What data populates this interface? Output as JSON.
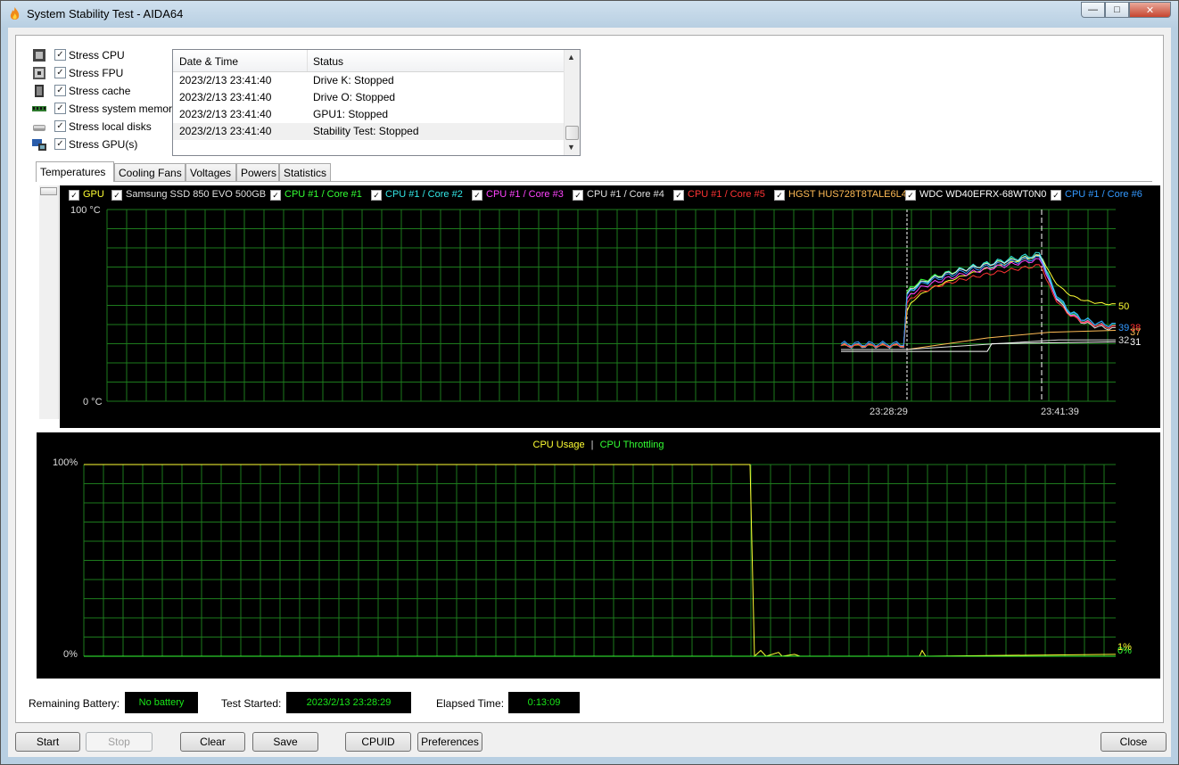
{
  "window": {
    "title": "System Stability Test - AIDA64",
    "min_glyph": "—",
    "max_glyph": "□",
    "close_glyph": "✕"
  },
  "stress_options": [
    {
      "label": "Stress CPU",
      "checked": true,
      "icon": "cpu-icon"
    },
    {
      "label": "Stress FPU",
      "checked": true,
      "icon": "fpu-icon"
    },
    {
      "label": "Stress cache",
      "checked": true,
      "icon": "cache-icon"
    },
    {
      "label": "Stress system memory",
      "checked": true,
      "icon": "memory-icon"
    },
    {
      "label": "Stress local disks",
      "checked": true,
      "icon": "disk-icon"
    },
    {
      "label": "Stress GPU(s)",
      "checked": true,
      "icon": "gpu-icon"
    }
  ],
  "log": {
    "headers": {
      "datetime": "Date & Time",
      "status": "Status"
    },
    "rows": [
      {
        "datetime": "2023/2/13 23:41:40",
        "status": "Drive K: Stopped"
      },
      {
        "datetime": "2023/2/13 23:41:40",
        "status": "Drive O: Stopped"
      },
      {
        "datetime": "2023/2/13 23:41:40",
        "status": "GPU1: Stopped"
      },
      {
        "datetime": "2023/2/13 23:41:40",
        "status": "Stability Test: Stopped"
      }
    ]
  },
  "tabs": [
    "Temperatures",
    "Cooling Fans",
    "Voltages",
    "Powers",
    "Statistics"
  ],
  "temperature_graph": {
    "legend": [
      {
        "label": "GPU",
        "color": "#ffff33"
      },
      {
        "label": "Samsung SSD 850 EVO 500GB",
        "color": "#e0e0e0"
      },
      {
        "label": "CPU #1 / Core #1",
        "color": "#33ff33"
      },
      {
        "label": "CPU #1 / Core #2",
        "color": "#33e6e6"
      },
      {
        "label": "CPU #1 / Core #3",
        "color": "#ff44ff"
      },
      {
        "label": "CPU #1 / Core #4",
        "color": "#e0e0e0"
      },
      {
        "label": "CPU #1 / Core #5",
        "color": "#ff3333"
      },
      {
        "label": "HGST HUS728T8TALE6L4",
        "color": "#ffbb55"
      },
      {
        "label": "WDC WD40EFRX-68WT0N0",
        "color": "#ffffff"
      },
      {
        "label": "CPU #1 / Core #6",
        "color": "#3399ff"
      }
    ],
    "y_max_label": "100 °C",
    "y_min_label": "0 °C",
    "time_start": "23:28:29",
    "time_end": "23:41:39",
    "end_values": [
      {
        "text": "50",
        "color": "#ffff33"
      },
      {
        "text": "39",
        "color": "#3399ff"
      },
      {
        "text": "38",
        "color": "#ff3333"
      },
      {
        "text": "37",
        "color": "#ffbb55"
      },
      {
        "text": "32",
        "color": "#e0e0e0"
      },
      {
        "text": "31",
        "color": "#ffffff"
      }
    ]
  },
  "cpu_graph": {
    "title_usage": "CPU Usage",
    "separator": "|",
    "title_throttling": "CPU Throttling",
    "usage_color": "#ffff33",
    "throttle_color": "#33ff33",
    "y_max_label": "100%",
    "y_min_label": "0%",
    "end_value_throttle": "0%",
    "end_value_usage": "1%"
  },
  "status_bar": {
    "battery_label": "Remaining Battery:",
    "battery_value": "No battery",
    "started_label": "Test Started:",
    "started_value": "2023/2/13 23:28:29",
    "elapsed_label": "Elapsed Time:",
    "elapsed_value": "0:13:09"
  },
  "buttons": {
    "start": "Start",
    "stop": "Stop",
    "clear": "Clear",
    "save": "Save",
    "cpuid": "CPUID",
    "preferences": "Preferences",
    "close": "Close"
  }
}
